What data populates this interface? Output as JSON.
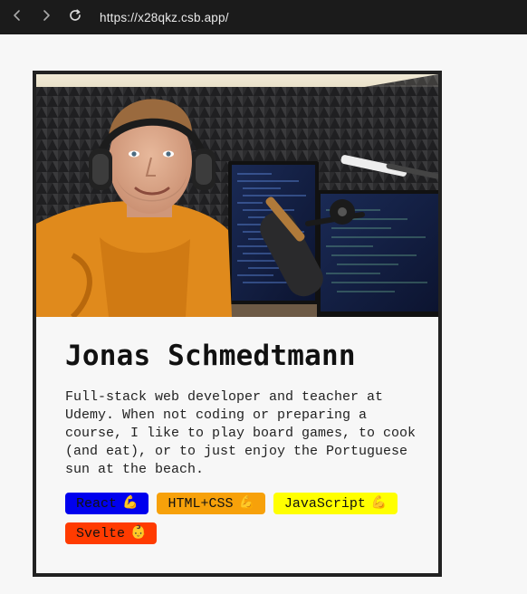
{
  "browser": {
    "url": "https://x28qkz.csb.app/",
    "icons": {
      "back": "chevron-left-icon",
      "forward": "chevron-right-icon",
      "reload": "reload-icon"
    }
  },
  "profile": {
    "name": "Jonas Schmedtmann",
    "bio": "Full-stack web developer and teacher at Udemy. When not coding or preparing a course, I like to play board games, to cook (and eat), or to just enjoy the Portuguese sun at the beach.",
    "photo": {
      "subject": "person-with-headphones-and-microphone"
    },
    "skills": [
      {
        "label": "React",
        "emoji": "💪",
        "color": "#0000ee"
      },
      {
        "label": "HTML+CSS",
        "emoji": "💪",
        "color": "#f7a10a"
      },
      {
        "label": "JavaScript",
        "emoji": "💪",
        "color": "#ffff00"
      },
      {
        "label": "Svelte",
        "emoji": "👶",
        "color": "#ff3b00"
      }
    ]
  },
  "colors": {
    "page_bg": "#f7f7f7",
    "card_border": "#222222",
    "topbar_bg": "#1b1b1b"
  }
}
